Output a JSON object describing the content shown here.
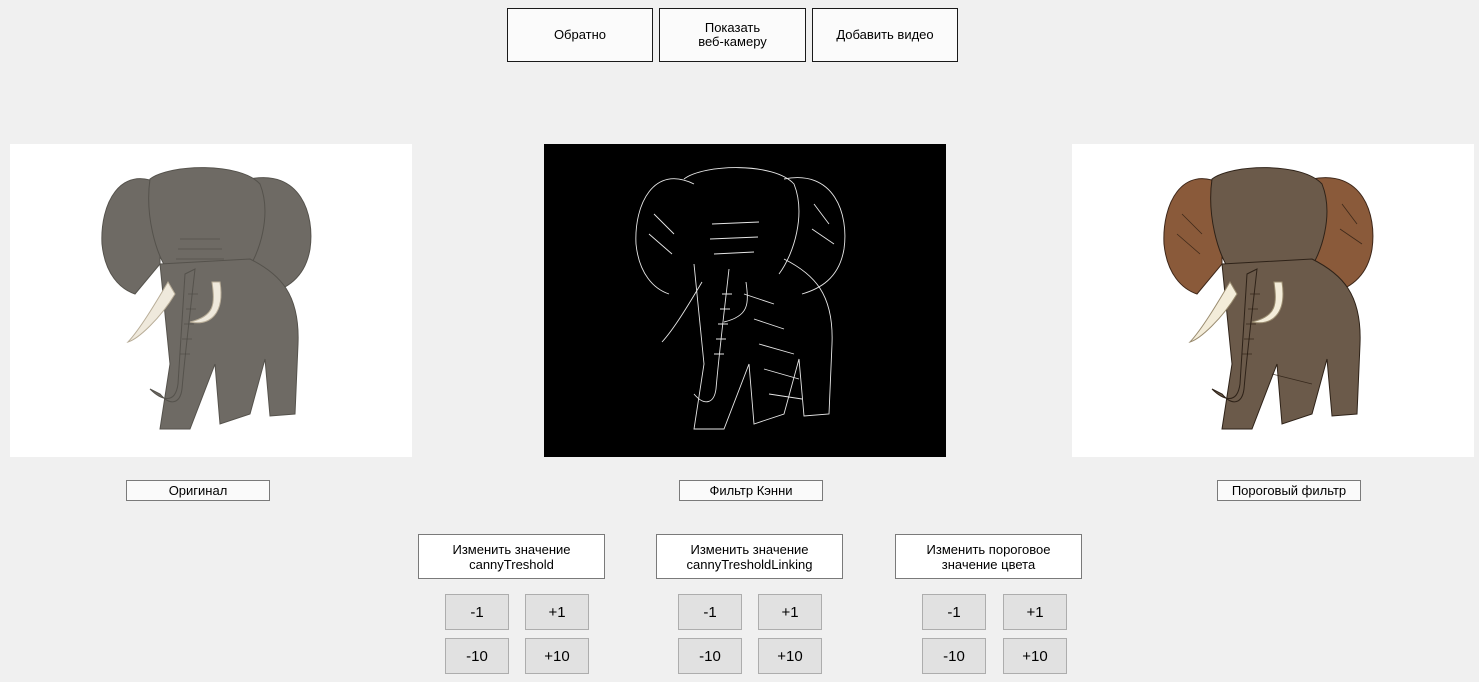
{
  "toolbar": {
    "back_label": "Обратно",
    "webcam_label": "Показать\nвеб-камеру",
    "add_video_label": "Добавить видео"
  },
  "panels": {
    "original_label": "Оригинал",
    "canny_label": "Фильтр Кэнни",
    "threshold_label": "Пороговый фильтр"
  },
  "controls": [
    {
      "title": "Изменить значение\ncannyTreshold",
      "minus1": "-1",
      "plus1": "+1",
      "minus10": "-10",
      "plus10": "+10"
    },
    {
      "title": "Изменить значение\ncannyTresholdLinking",
      "minus1": "-1",
      "plus1": "+1",
      "minus10": "-10",
      "plus10": "+10"
    },
    {
      "title": "Изменить пороговое\nзначение цвета",
      "minus1": "-1",
      "plus1": "+1",
      "minus10": "-10",
      "plus10": "+10"
    }
  ],
  "colors": {
    "background": "#f0f0f0",
    "elephant_gray": "#6e6a64",
    "canny_bg": "#000000",
    "threshold_tint": "#8a5a3a"
  }
}
